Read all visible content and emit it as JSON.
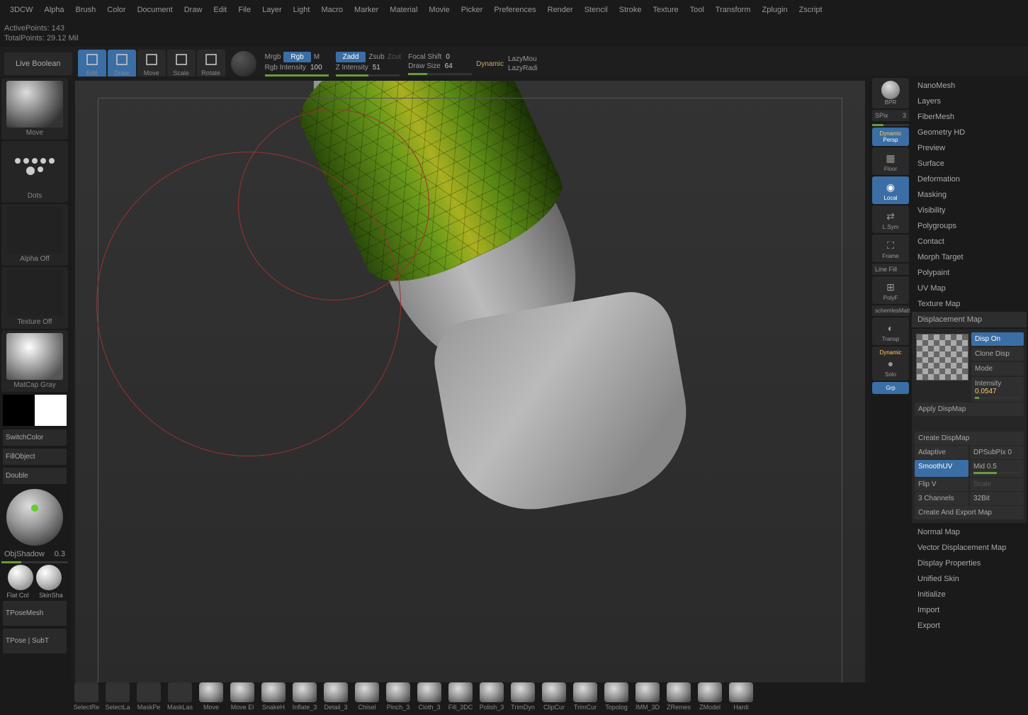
{
  "menu": [
    "3DCW",
    "Alpha",
    "Brush",
    "Color",
    "Document",
    "Draw",
    "Edit",
    "File",
    "Layer",
    "Light",
    "Macro",
    "Marker",
    "Material",
    "Movie",
    "Picker",
    "Preferences",
    "Render",
    "Stencil",
    "Stroke",
    "Texture",
    "Tool",
    "Transform",
    "Zplugin",
    "Zscript"
  ],
  "stats": {
    "active_label": "ActivePoints:",
    "active_val": "143",
    "total_label": "TotalPoints:",
    "total_val": "29.12 Mil"
  },
  "toolbar": {
    "live_boolean": "Live Boolean",
    "modes": [
      {
        "lbl": "Edit",
        "k": "Q",
        "on": true
      },
      {
        "lbl": "Draw",
        "k": "",
        "on": true
      },
      {
        "lbl": "Move",
        "k": "M",
        "on": false
      },
      {
        "lbl": "Scale",
        "k": "S",
        "on": false
      },
      {
        "lbl": "Rotate",
        "k": "R",
        "on": false
      }
    ],
    "mrgb": "Mrgb",
    "rgb": "Rgb",
    "m": "M",
    "zadd": "Zadd",
    "zsub": "Zsub",
    "zcut": "Zcut",
    "rgb_intensity_lbl": "Rgb Intensity",
    "rgb_intensity_val": "100",
    "z_intensity_lbl": "Z Intensity",
    "z_intensity_val": "51",
    "focal_shift_lbl": "Focal Shift",
    "focal_shift_val": "0",
    "draw_size_lbl": "Draw Size",
    "draw_size_val": "64",
    "dynamic": "Dynamic",
    "lazymouse": "LazyMou",
    "lazyradius": "LazyRadi"
  },
  "left": {
    "move": "Move",
    "dots": "Dots",
    "alpha_off": "Alpha Off",
    "texture_off": "Texture Off",
    "matcap": "MatCap Gray",
    "switchcolor": "SwitchColor",
    "fillobject": "FillObject",
    "double": "Double",
    "objshadow_lbl": "ObjShadow",
    "objshadow_val": "0.3",
    "flatcol": "Flat Col",
    "skinsha": "SkinSha",
    "tposemesh": "TPoseMesh",
    "tposesubt": "TPose | SubT"
  },
  "shelf": [
    "SelectRe",
    "SelectLa",
    "MaskPe",
    "MaskLas",
    "Move",
    "Move El",
    "SnakeH",
    "Inflate_3",
    "Detail_3",
    "Chisel",
    "Pinch_3",
    "Cloth_3",
    "Fill_3DC",
    "Polish_3",
    "TrimDyn",
    "ClipCur",
    "TrimCur",
    "Topolog",
    "IMM_3D",
    "ZRemes",
    "ZModel",
    "Hardi"
  ],
  "vtool": {
    "bpr": "BPR",
    "spix_lbl": "SPix",
    "spix_val": "3",
    "dynamic": "Dynamic",
    "persp": "Persp",
    "floor": "Floor",
    "local": "Local",
    "lsym": "L.Sym",
    "frame": "Frame",
    "linefill": "Line Fill",
    "polyf": "PolyF",
    "transp": "Transp",
    "solo": "Solo",
    "dyn2": "Dynamic",
    "grp": "Grp",
    "schemles": "schemlesMatt"
  },
  "right": {
    "items_top": [
      "NanoMesh",
      "Layers",
      "FiberMesh",
      "Geometry HD",
      "Preview",
      "Surface",
      "Deformation",
      "Masking",
      "Visibility",
      "Polygroups",
      "Contact",
      "Morph Target",
      "Polypaint",
      "UV Map",
      "Texture Map"
    ],
    "disp_label": "Displacement Map",
    "disp": {
      "dispon": "Disp On",
      "clonedisp": "Clone Disp",
      "mode": "Mode",
      "intensity_lbl": "Intensity",
      "intensity_val": "0.0547",
      "apply": "Apply DispMap",
      "create": "Create DispMap",
      "adaptive": "Adaptive",
      "dpsubpix_lbl": "DPSubPix",
      "dpsubpix_val": "0",
      "smoothuv": "SmoothUV",
      "mid_lbl": "Mid",
      "mid_val": "0.5",
      "flipv": "Flip V",
      "scale": "Scale",
      "channels": "3 Channels",
      "bit32": "32Bit",
      "export": "Create And Export Map"
    },
    "items_bot": [
      "Normal Map",
      "Vector Displacement Map",
      "Display Properties",
      "Unified Skin",
      "Initialize",
      "Import",
      "Export"
    ]
  }
}
